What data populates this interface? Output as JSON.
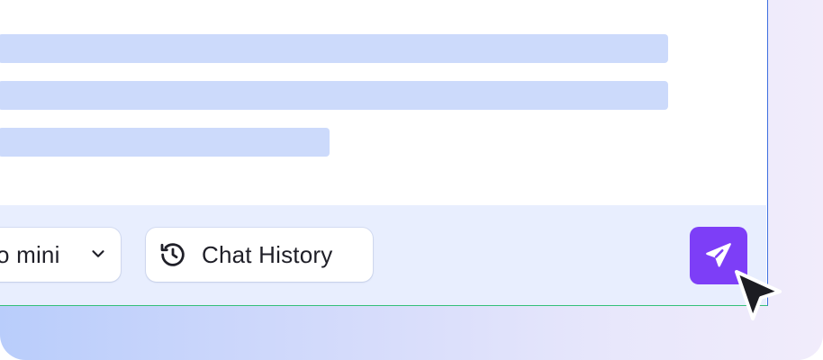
{
  "colors": {
    "accent": "#7d3ef7",
    "skeleton": "#ccdafb",
    "toolbar_bg": "#e8eefe"
  },
  "toolbar": {
    "model_selector": {
      "label": "o mini",
      "icon": "chevron-down-icon"
    },
    "chat_history": {
      "label": "Chat History",
      "icon": "history-icon"
    },
    "send": {
      "icon": "send-icon"
    }
  },
  "cursor": {
    "icon": "mouse-pointer-icon"
  }
}
